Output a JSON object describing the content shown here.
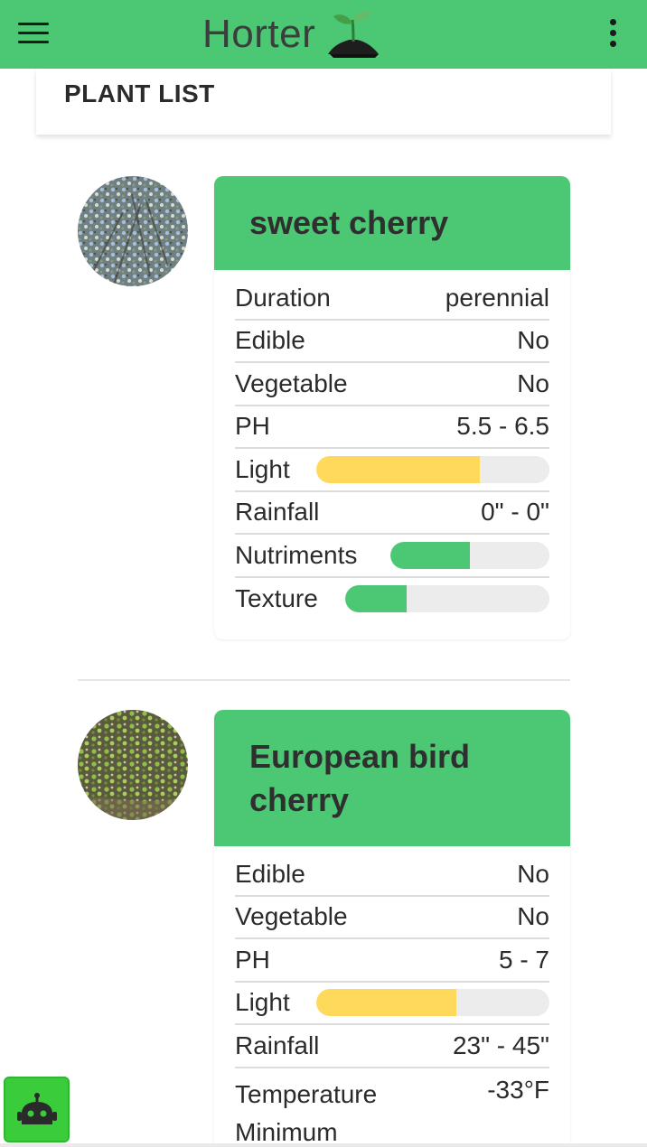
{
  "app": {
    "title": "Horter"
  },
  "header": {
    "title": "PLANT LIST"
  },
  "colors": {
    "accent": "#4cc774",
    "light_bar": "#ffd95c",
    "bar_track": "#ececec",
    "bot_button": "#3bcc3b"
  },
  "icons": {
    "menu": "hamburger-menu-icon",
    "more": "kebab-menu-icon",
    "logo": "sprout-logo-icon",
    "bot": "robot-icon"
  },
  "plants": [
    {
      "name": "sweet cherry",
      "rows": [
        {
          "label": "Duration",
          "value": "perennial"
        },
        {
          "label": "Edible",
          "value": "No"
        },
        {
          "label": "Vegetable",
          "value": "No"
        },
        {
          "label": "PH",
          "value": "5.5 - 6.5"
        },
        {
          "label": "Light",
          "bar": 0.7,
          "bar_color": "yellow"
        },
        {
          "label": "Rainfall",
          "value": "0\" - 0\""
        },
        {
          "label": "Nutriments",
          "bar": 0.5,
          "bar_color": "green"
        },
        {
          "label": "Texture",
          "bar": 0.3,
          "bar_color": "green"
        }
      ]
    },
    {
      "name": "European bird cherry",
      "rows": [
        {
          "label": "Edible",
          "value": "No"
        },
        {
          "label": "Vegetable",
          "value": "No"
        },
        {
          "label": "PH",
          "value": "5 - 7"
        },
        {
          "label": "Light",
          "bar": 0.6,
          "bar_color": "yellow"
        },
        {
          "label": "Rainfall",
          "value": "23\" - 45\""
        },
        {
          "label": "Temperature Minimum",
          "value": "-33°F"
        }
      ]
    }
  ]
}
